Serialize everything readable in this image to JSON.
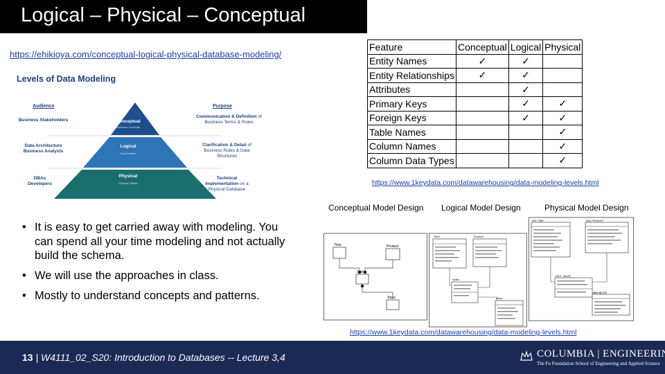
{
  "slide": {
    "title": "Logical – Physical – Conceptual",
    "link_left": "https://ehikioya.com/conceptual-logical-physical-database-modeling/",
    "link_table": "https://www.1keydata.com/datawarehousing/data-modeling-levels.html",
    "link_diagram": "https://www.1keydata.com/datawarehousing/data-modeling-levels.html"
  },
  "pyramid": {
    "title": "Levels of Data Modeling",
    "audience_header": "Audience",
    "purpose_header": "Purpose",
    "levels": [
      {
        "name": "Conceptual",
        "sub": "Business Concepts",
        "audience": "Business Stakeholders",
        "purpose_bold": "Communication & Definition",
        "purpose_rest": "of Business Terms & Rules"
      },
      {
        "name": "Logical",
        "sub": "Data Entities",
        "audience": "Data Architecture\nBusiness Analysts",
        "purpose_bold": "Clarification & Detail",
        "purpose_rest": "of Business Rules & Data Structures"
      },
      {
        "name": "Physical",
        "sub": "Physical Tables",
        "audience": "DBAs\nDevelopers",
        "purpose_bold": "Technical Implementation",
        "purpose_rest": "on a Physical Database"
      }
    ],
    "colors": {
      "top": "#1f4e8c",
      "middle": "#2e75b6",
      "bottom": "#1b6e6e"
    }
  },
  "feature_table": {
    "headers": [
      "Feature",
      "Conceptual",
      "Logical",
      "Physical"
    ],
    "rows": [
      {
        "feature": "Entity Names",
        "conceptual": "✓",
        "logical": "✓",
        "physical": ""
      },
      {
        "feature": "Entity Relationships",
        "conceptual": "✓",
        "logical": "✓",
        "physical": ""
      },
      {
        "feature": "Attributes",
        "conceptual": "",
        "logical": "✓",
        "physical": ""
      },
      {
        "feature": "Primary Keys",
        "conceptual": "",
        "logical": "✓",
        "physical": "✓"
      },
      {
        "feature": "Foreign Keys",
        "conceptual": "",
        "logical": "✓",
        "physical": "✓"
      },
      {
        "feature": "Table Names",
        "conceptual": "",
        "logical": "",
        "physical": "✓"
      },
      {
        "feature": "Column Names",
        "conceptual": "",
        "logical": "",
        "physical": "✓"
      },
      {
        "feature": "Column Data Types",
        "conceptual": "",
        "logical": "",
        "physical": "✓"
      }
    ]
  },
  "design": {
    "conceptual_title": "Conceptual Model Design",
    "logical_title": "Logical Model Design",
    "physical_title": "Physical Model Design",
    "conceptual_entities": [
      "Time",
      "Product",
      "Sales",
      "Store"
    ],
    "logical_entities": [
      "Time",
      "Product",
      "Sales",
      "Store"
    ],
    "physical_entities": [
      "DIM_TIME",
      "DIM_PRODUCT",
      "FACT_SALES",
      "DIM_STORE"
    ]
  },
  "bullets": [
    "It is easy to get carried away with modeling. You can spend all your time modeling and not actually build the schema.",
    "We will use the approaches in class.",
    "Mostly to understand concepts and patterns."
  ],
  "footer": {
    "page_number": "13",
    "course_text": " | W4111_02_S20:  Introduction to Databases -- Lecture  3,4",
    "logo_main": "COLUMBIA | ENGINEERING",
    "logo_sub": "The Fu Foundation School of Engineering and Applied Science"
  }
}
